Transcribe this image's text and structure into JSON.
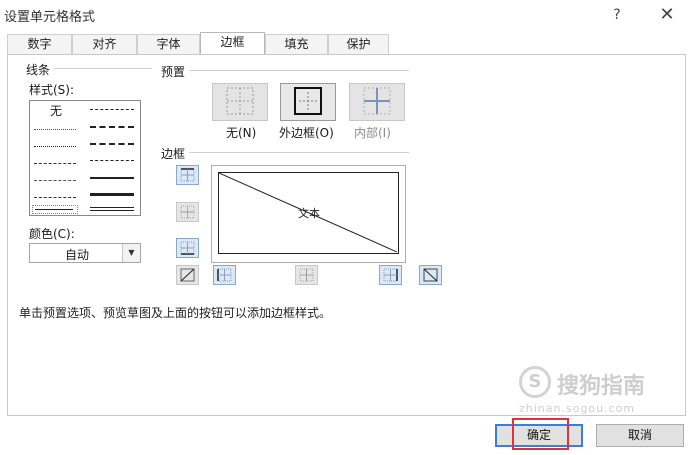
{
  "window": {
    "title": "设置单元格格式",
    "help_glyph": "?",
    "close_glyph": "✕"
  },
  "tabs": [
    {
      "label": "数字"
    },
    {
      "label": "对齐"
    },
    {
      "label": "字体"
    },
    {
      "label": "边框",
      "active": true
    },
    {
      "label": "填充"
    },
    {
      "label": "保护"
    }
  ],
  "line_section": {
    "header": "线条",
    "style_label": "样式(S):",
    "none_label": "无",
    "color_label": "颜色(C):",
    "color_value": "自动",
    "dropdown_glyph": "▼"
  },
  "presets": {
    "header": "预置",
    "none_label": "无(N)",
    "outline_label": "外边框(O)",
    "inside_label": "内部(I)"
  },
  "border": {
    "header": "边框",
    "preview_text": "文本"
  },
  "hint": "单击预置选项、预览草图及上面的按钮可以添加边框样式。",
  "footer": {
    "ok_label": "确定",
    "cancel_label": "取消"
  },
  "watermark": {
    "logo_glyph": "S",
    "text": "搜狗指南",
    "url": "zhinan.sogou.com"
  },
  "colors": {
    "accent": "#3b7ed6",
    "highlight": "#e0313d",
    "button_active_bg": "#dbe8f6"
  }
}
